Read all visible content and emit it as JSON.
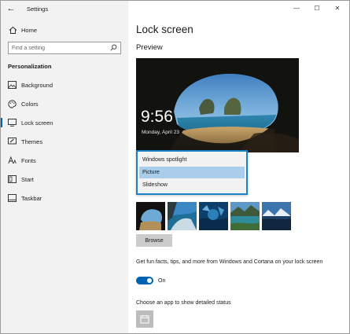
{
  "window": {
    "title": "Settings",
    "controls": {
      "minimize": "—",
      "maximize": "☐",
      "close": "✕"
    }
  },
  "sidebar": {
    "back_glyph": "←",
    "home_label": "Home",
    "search_placeholder": "Find a setting",
    "section_title": "Personalization",
    "items": [
      {
        "label": "Background",
        "icon": "picture-icon"
      },
      {
        "label": "Colors",
        "icon": "palette-icon"
      },
      {
        "label": "Lock screen",
        "icon": "lock-screen-icon",
        "active": true
      },
      {
        "label": "Themes",
        "icon": "brush-icon"
      },
      {
        "label": "Fonts",
        "icon": "fonts-icon"
      },
      {
        "label": "Start",
        "icon": "start-icon"
      },
      {
        "label": "Taskbar",
        "icon": "taskbar-icon"
      }
    ]
  },
  "main": {
    "page_title": "Lock screen",
    "preview_heading": "Preview",
    "preview": {
      "time": "9:56",
      "date": "Monday, April 23"
    },
    "background_dropdown": {
      "options": [
        "Windows spotlight",
        "Picture",
        "Slideshow"
      ],
      "selected": "Picture"
    },
    "browse_label": "Browse",
    "fun_facts_text": "Get fun facts, tips, and more from Windows and Cortana on your lock screen",
    "toggle_state": "On",
    "status_heading": "Choose an app to show detailed status"
  },
  "colors": {
    "accent": "#0063b1",
    "dropdown_border": "#1a82c8",
    "dropdown_selected": "#a9cdeb",
    "sidebar_bg": "#f2f2f2"
  }
}
